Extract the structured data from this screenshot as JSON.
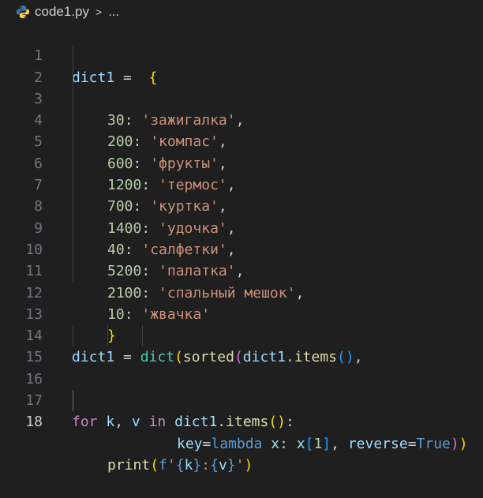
{
  "breadcrumb": {
    "file": "code1.py",
    "separator": ">",
    "more": "..."
  },
  "editor": {
    "line_numbers": [
      "1",
      "2",
      "3",
      "4",
      "5",
      "6",
      "7",
      "8",
      "9",
      "10",
      "11",
      "12",
      "13",
      "14",
      "15",
      "16",
      "17",
      "18"
    ],
    "line1": {
      "var": "dict1",
      "op": " =  ",
      "brace": "{"
    },
    "entries": [
      {
        "key": "30",
        "value": "'зажигалка'"
      },
      {
        "key": "200",
        "value": "'компас'"
      },
      {
        "key": "600",
        "value": "'фрукты'"
      },
      {
        "key": "1200",
        "value": "'термос'"
      },
      {
        "key": "700",
        "value": "'куртка'"
      },
      {
        "key": "1400",
        "value": "'удочка'"
      },
      {
        "key": "40",
        "value": "'салфетки'"
      },
      {
        "key": "5200",
        "value": "'палатка'"
      },
      {
        "key": "2100",
        "value": "'спальный мешок'"
      },
      {
        "key": "10",
        "value": "'жвачка'"
      }
    ],
    "close_brace": "}",
    "line14": {
      "var": "dict1",
      "op": " = ",
      "dict": "dict",
      "sorted": "sorted",
      "obj": "dict1",
      "method": "items"
    },
    "line15": {
      "key": "key",
      "lambda": "lambda",
      "x1": "x",
      "x2": "x",
      "idx": "1",
      "reverse": "reverse",
      "true": "True"
    },
    "line17": {
      "for": "for",
      "k": "k",
      "v": "v",
      "in": "in",
      "obj": "dict1",
      "method": "items"
    },
    "line18": {
      "print": "print",
      "f": "f",
      "k": "k",
      "v": "v"
    }
  }
}
